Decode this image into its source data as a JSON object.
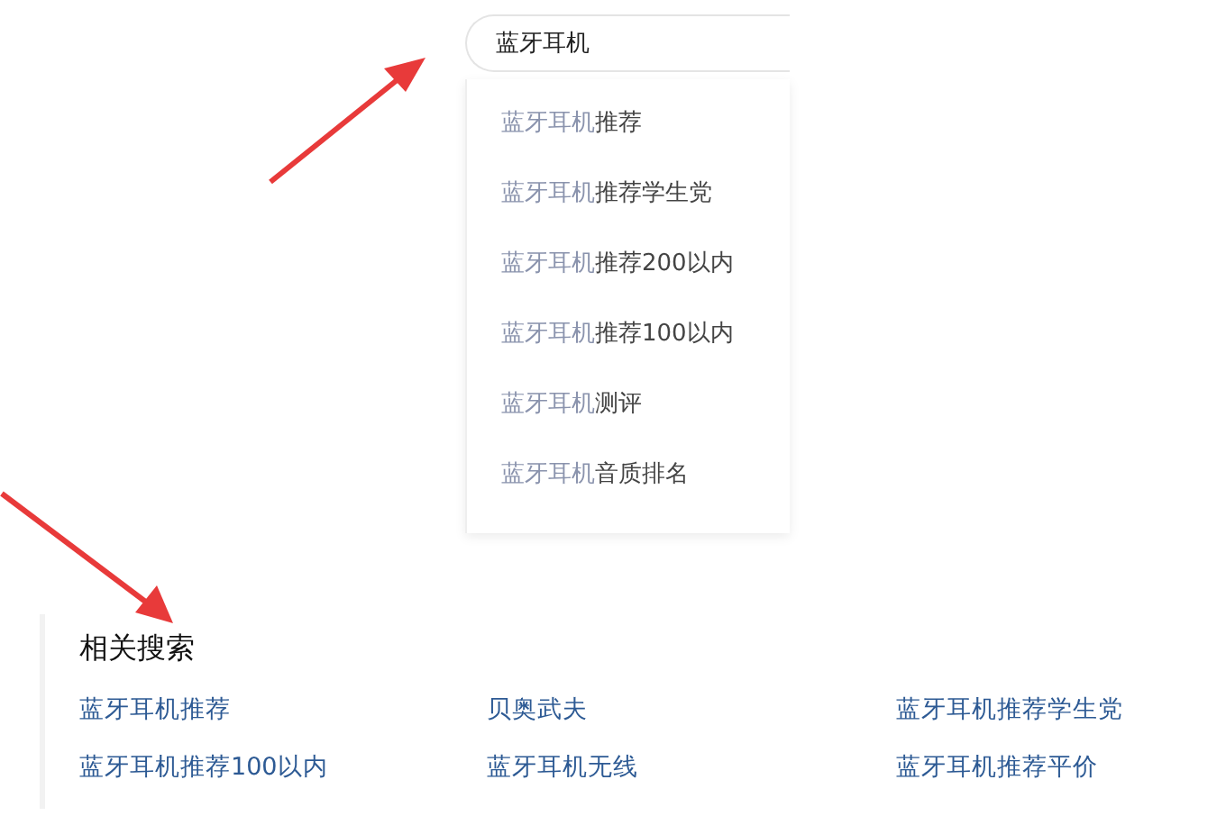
{
  "search": {
    "value": "蓝牙耳机"
  },
  "suggestions": [
    {
      "match": "蓝牙耳机",
      "rest": "推荐"
    },
    {
      "match": "蓝牙耳机",
      "rest": "推荐学生党"
    },
    {
      "match": "蓝牙耳机",
      "rest": "推荐200以内"
    },
    {
      "match": "蓝牙耳机",
      "rest": "推荐100以内"
    },
    {
      "match": "蓝牙耳机",
      "rest": "测评"
    },
    {
      "match": "蓝牙耳机",
      "rest": "音质排名"
    }
  ],
  "related": {
    "title": "相关搜索",
    "links": [
      "蓝牙耳机推荐",
      "贝奥武夫",
      "蓝牙耳机推荐学生党",
      "蓝牙耳机推荐100以内",
      "蓝牙耳机无线",
      "蓝牙耳机推荐平价"
    ]
  }
}
